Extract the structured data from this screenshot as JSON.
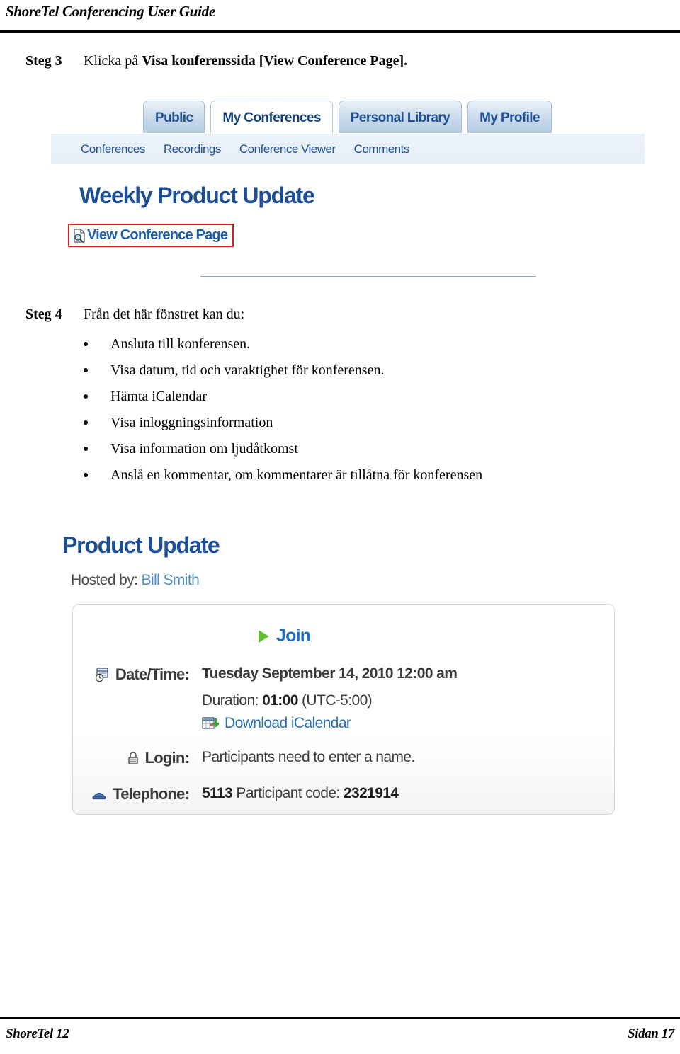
{
  "header": {
    "title": "ShoreTel Conferencing User Guide"
  },
  "footer": {
    "left": "ShoreTel 12",
    "right": "Sidan 17"
  },
  "steps": {
    "step3": {
      "label": "Steg 3",
      "text_plain": "Klicka på Visa konferenssida [View Conference Page].",
      "text_prefix": "Klicka på ",
      "text_bold": "Visa konferenssida [View Conference Page]",
      "text_suffix": "."
    },
    "step4": {
      "label": "Steg 4",
      "text": "Från det här fönstret kan du:"
    }
  },
  "bullets": [
    "Ansluta till konferensen.",
    "Visa datum, tid och varaktighet för konferensen.",
    "Hämta iCalendar",
    "Visa inloggningsinformation",
    "Visa information om ljudåtkomst",
    "Anslå en kommentar, om kommentarer är tillåtna för konferensen"
  ],
  "screenshot_tabs": {
    "tabs": [
      {
        "label": "Public",
        "active": false
      },
      {
        "label": "My Conferences",
        "active": true
      },
      {
        "label": "Personal Library",
        "active": false
      },
      {
        "label": "My Profile",
        "active": false
      }
    ],
    "subnav": [
      "Conferences",
      "Recordings",
      "Conference Viewer",
      "Comments"
    ],
    "conference_title": "Weekly Product Update",
    "view_conference_link": "View Conference Page",
    "view_conference_icon": "document-search-icon",
    "highlight_color": "#e01b1b"
  },
  "screenshot_conference": {
    "title": "Product Update",
    "hosted_by_label": "Hosted by:",
    "host_name": "Bill Smith",
    "join_label": "Join",
    "join_icon": "play-icon",
    "rows": {
      "datetime": {
        "icon": "calendar-clock-icon",
        "label": "Date/Time:",
        "value": "Tuesday September 14, 2010 12:00 am",
        "duration_label": "Duration:",
        "duration_value": "01:00",
        "timezone": "(UTC-5:00)",
        "ical_icon": "calendar-download-icon",
        "ical_label": "Download iCalendar"
      },
      "login": {
        "icon": "padlock-icon",
        "label": "Login:",
        "value": "Participants need to enter a name."
      },
      "telephone": {
        "icon": "telephone-icon",
        "label": "Telephone:",
        "number": "5113",
        "code_label": "Participant code:",
        "code_value": "2321914"
      }
    }
  },
  "colors": {
    "brand_blue": "#1c4f96",
    "link_blue": "#2a72b5",
    "tab_text": "#1f4f95",
    "join_green": "#5fbd32",
    "highlight_red": "#e01b1b"
  }
}
